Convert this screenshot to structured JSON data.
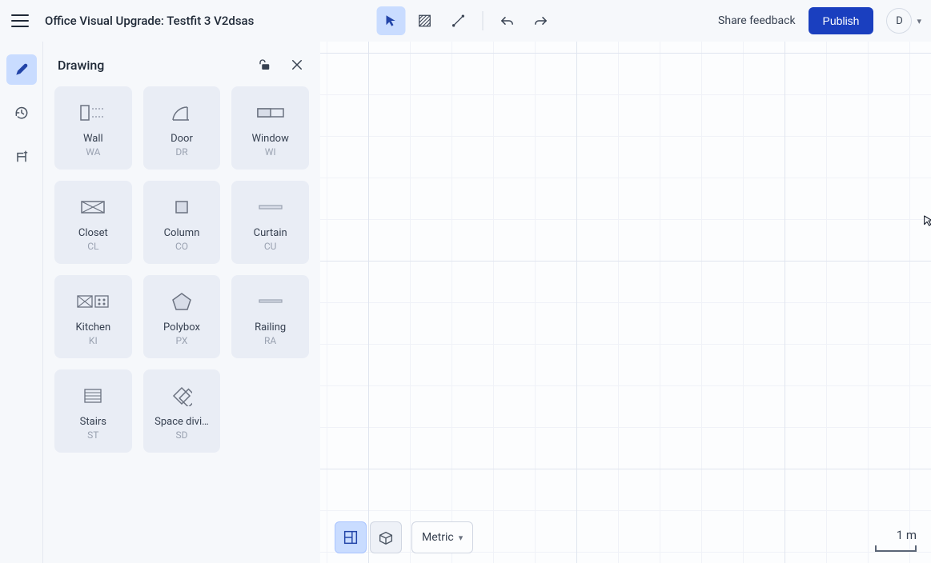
{
  "header": {
    "title": "Office Visual Upgrade: Testfit 3 V2dsas",
    "share_label": "Share feedback",
    "publish_label": "Publish",
    "avatar_initial": "D"
  },
  "panel": {
    "title": "Drawing",
    "tools": [
      {
        "label": "Wall",
        "code": "WA"
      },
      {
        "label": "Door",
        "code": "DR"
      },
      {
        "label": "Window",
        "code": "WI"
      },
      {
        "label": "Closet",
        "code": "CL"
      },
      {
        "label": "Column",
        "code": "CO"
      },
      {
        "label": "Curtain",
        "code": "CU"
      },
      {
        "label": "Kitchen",
        "code": "KI"
      },
      {
        "label": "Polybox",
        "code": "PX"
      },
      {
        "label": "Railing",
        "code": "RA"
      },
      {
        "label": "Stairs",
        "code": "ST"
      },
      {
        "label": "Space divi…",
        "code": "SD"
      }
    ]
  },
  "bottom": {
    "units_label": "Metric",
    "scale_label": "1 m"
  }
}
